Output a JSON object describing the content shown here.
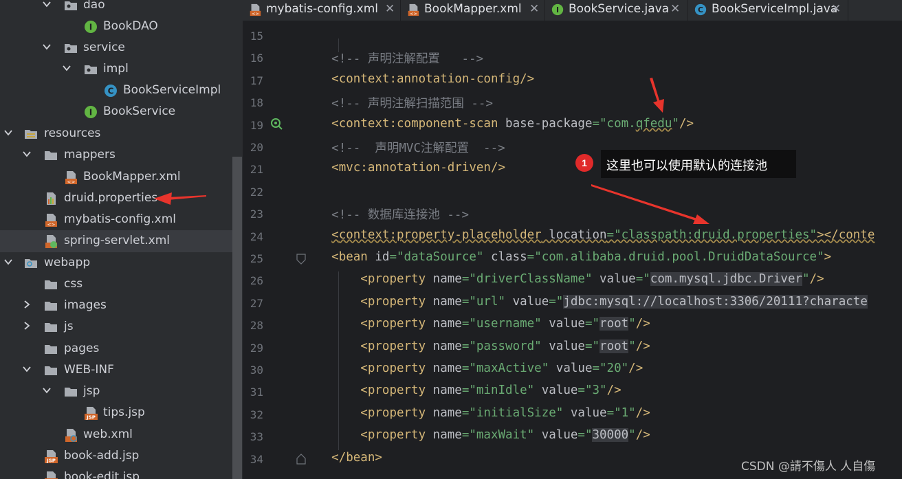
{
  "project_tree": [
    {
      "label": "dao",
      "icon": "package-folder-icon",
      "expanded": true
    },
    {
      "label": "BookDAO",
      "icon": "interface-icon"
    },
    {
      "label": "service",
      "icon": "package-folder-icon",
      "expanded": true
    },
    {
      "label": "impl",
      "icon": "package-folder-icon",
      "expanded": true
    },
    {
      "label": "BookServiceImpl",
      "icon": "class-icon"
    },
    {
      "label": "BookService",
      "icon": "interface-icon"
    },
    {
      "label": "resources",
      "icon": "resources-folder-icon",
      "expanded": true
    },
    {
      "label": "mappers",
      "icon": "folder-icon",
      "expanded": true
    },
    {
      "label": "BookMapper.xml",
      "icon": "xml-file-icon"
    },
    {
      "label": "druid.properties",
      "icon": "properties-file-icon"
    },
    {
      "label": "mybatis-config.xml",
      "icon": "xml-file-icon"
    },
    {
      "label": "spring-servlet.xml",
      "icon": "spring-xml-icon",
      "selected": true
    },
    {
      "label": "webapp",
      "icon": "web-folder-icon",
      "expanded": true
    },
    {
      "label": "css",
      "icon": "folder-icon"
    },
    {
      "label": "images",
      "icon": "folder-icon",
      "expanded": false
    },
    {
      "label": "js",
      "icon": "folder-icon",
      "expanded": false
    },
    {
      "label": "pages",
      "icon": "folder-icon"
    },
    {
      "label": "WEB-INF",
      "icon": "folder-icon",
      "expanded": true
    },
    {
      "label": "jsp",
      "icon": "folder-icon",
      "expanded": true
    },
    {
      "label": "tips.jsp",
      "icon": "jsp-file-icon"
    },
    {
      "label": "web.xml",
      "icon": "web-xml-icon"
    },
    {
      "label": "book-add.jsp",
      "icon": "jsp-file-icon"
    },
    {
      "label": "book-edit.jsp",
      "icon": "jsp-file-icon"
    }
  ],
  "tabs": [
    {
      "label": "mybatis-config.xml",
      "icon": "xml-file-icon",
      "close": "✕"
    },
    {
      "label": "BookMapper.xml",
      "icon": "xml-file-icon",
      "close": "✕"
    },
    {
      "label": "BookService.java",
      "icon": "interface-icon",
      "close": "✕"
    },
    {
      "label": "BookServiceImpl.java",
      "icon": "class-icon",
      "close": "✕"
    }
  ],
  "editor": {
    "line_numbers": [
      "15",
      "16",
      "17",
      "18",
      "19",
      "20",
      "21",
      "22",
      "23",
      "24",
      "25",
      "26",
      "27",
      "28",
      "29",
      "30",
      "31",
      "32",
      "33",
      "34"
    ],
    "lines": [
      [],
      [
        {
          "t": "    "
        },
        {
          "t": "<!-- 声明注解配置   -->",
          "c": "cm"
        }
      ],
      [
        {
          "t": "    "
        },
        {
          "t": "<",
          "c": "tg"
        },
        {
          "t": "context:",
          "c": "nm"
        },
        {
          "t": "annotation-config",
          "c": "tg"
        },
        {
          "t": "/>",
          "c": "tg"
        }
      ],
      [
        {
          "t": "    "
        },
        {
          "t": "<!-- 声明注解扫描范围 -->",
          "c": "cm"
        }
      ],
      [
        {
          "t": "    "
        },
        {
          "t": "<",
          "c": "tg"
        },
        {
          "t": "context:",
          "c": "nm"
        },
        {
          "t": "component-scan",
          "c": "tg"
        },
        {
          "t": " base-package",
          "c": "at"
        },
        {
          "t": "=\"com.",
          "c": "st"
        },
        {
          "t": "qfedu",
          "c": "st sq"
        },
        {
          "t": "\"",
          "c": "st"
        },
        {
          "t": "/>",
          "c": "tg"
        }
      ],
      [
        {
          "t": "    "
        },
        {
          "t": "<!--  声明MVC注解配置  -->",
          "c": "cm"
        }
      ],
      [
        {
          "t": "    "
        },
        {
          "t": "<",
          "c": "tg"
        },
        {
          "t": "mvc:",
          "c": "nm"
        },
        {
          "t": "annotation-driven",
          "c": "tg"
        },
        {
          "t": "/>",
          "c": "tg"
        }
      ],
      [],
      [
        {
          "t": "    "
        },
        {
          "t": "<!-- 数据库连接池 -->",
          "c": "cm"
        }
      ],
      [
        {
          "t": "    "
        },
        {
          "t": "<",
          "c": "tg sq"
        },
        {
          "t": "context:",
          "c": "nm sq"
        },
        {
          "t": "property-placeholder",
          "c": "tg sq"
        },
        {
          "t": " location",
          "c": "at sq"
        },
        {
          "t": "=\"classpath:druid.properties\"",
          "c": "st sq"
        },
        {
          "t": "></conte",
          "c": "tg sq"
        }
      ],
      [
        {
          "t": "    "
        },
        {
          "t": "<",
          "c": "tg"
        },
        {
          "t": "bean",
          "c": "tg"
        },
        {
          "t": " id",
          "c": "at"
        },
        {
          "t": "=\"dataSource\"",
          "c": "st"
        },
        {
          "t": " class",
          "c": "at"
        },
        {
          "t": "=\"com.alibaba.druid.pool.DruidDataSource\"",
          "c": "st"
        },
        {
          "t": ">",
          "c": "tg"
        }
      ],
      [
        {
          "t": "        "
        },
        {
          "t": "<",
          "c": "tg"
        },
        {
          "t": "property",
          "c": "tg"
        },
        {
          "t": " name",
          "c": "at"
        },
        {
          "t": "=\"driverClassName\"",
          "c": "st"
        },
        {
          "t": " value",
          "c": "at"
        },
        {
          "t": "=\"",
          "c": "st"
        },
        {
          "t": "com.mysql.jdbc.Driver",
          "c": "vh"
        },
        {
          "t": "\"",
          "c": "st"
        },
        {
          "t": "/>",
          "c": "tg"
        }
      ],
      [
        {
          "t": "        "
        },
        {
          "t": "<",
          "c": "tg"
        },
        {
          "t": "property",
          "c": "tg"
        },
        {
          "t": " name",
          "c": "at"
        },
        {
          "t": "=\"url\"",
          "c": "st"
        },
        {
          "t": " value",
          "c": "at"
        },
        {
          "t": "=\"",
          "c": "st"
        },
        {
          "t": "jdbc:mysql://localhost:3306/20111?characte",
          "c": "vh"
        }
      ],
      [
        {
          "t": "        "
        },
        {
          "t": "<",
          "c": "tg"
        },
        {
          "t": "property",
          "c": "tg"
        },
        {
          "t": " name",
          "c": "at"
        },
        {
          "t": "=\"username\"",
          "c": "st"
        },
        {
          "t": " value",
          "c": "at"
        },
        {
          "t": "=\"",
          "c": "st"
        },
        {
          "t": "root",
          "c": "vh"
        },
        {
          "t": "\"",
          "c": "st"
        },
        {
          "t": "/>",
          "c": "tg"
        }
      ],
      [
        {
          "t": "        "
        },
        {
          "t": "<",
          "c": "tg"
        },
        {
          "t": "property",
          "c": "tg"
        },
        {
          "t": " name",
          "c": "at"
        },
        {
          "t": "=\"password\"",
          "c": "st"
        },
        {
          "t": " value",
          "c": "at"
        },
        {
          "t": "=\"",
          "c": "st"
        },
        {
          "t": "root",
          "c": "vh"
        },
        {
          "t": "\"",
          "c": "st"
        },
        {
          "t": "/>",
          "c": "tg"
        }
      ],
      [
        {
          "t": "        "
        },
        {
          "t": "<",
          "c": "tg"
        },
        {
          "t": "property",
          "c": "tg"
        },
        {
          "t": " name",
          "c": "at"
        },
        {
          "t": "=\"maxActive\"",
          "c": "st"
        },
        {
          "t": " value",
          "c": "at"
        },
        {
          "t": "=\"20\"",
          "c": "st"
        },
        {
          "t": "/>",
          "c": "tg"
        }
      ],
      [
        {
          "t": "        "
        },
        {
          "t": "<",
          "c": "tg"
        },
        {
          "t": "property",
          "c": "tg"
        },
        {
          "t": " name",
          "c": "at"
        },
        {
          "t": "=\"minIdle\"",
          "c": "st"
        },
        {
          "t": " value",
          "c": "at"
        },
        {
          "t": "=\"3\"",
          "c": "st"
        },
        {
          "t": "/>",
          "c": "tg"
        }
      ],
      [
        {
          "t": "        "
        },
        {
          "t": "<",
          "c": "tg"
        },
        {
          "t": "property",
          "c": "tg"
        },
        {
          "t": " name",
          "c": "at"
        },
        {
          "t": "=\"initialSize\"",
          "c": "st"
        },
        {
          "t": " value",
          "c": "at"
        },
        {
          "t": "=\"1\"",
          "c": "st"
        },
        {
          "t": "/>",
          "c": "tg"
        }
      ],
      [
        {
          "t": "        "
        },
        {
          "t": "<",
          "c": "tg"
        },
        {
          "t": "property",
          "c": "tg"
        },
        {
          "t": " name",
          "c": "at"
        },
        {
          "t": "=\"maxWait\"",
          "c": "st"
        },
        {
          "t": " value",
          "c": "at"
        },
        {
          "t": "=\"",
          "c": "st"
        },
        {
          "t": "30000",
          "c": "vh"
        },
        {
          "t": "\"",
          "c": "st"
        },
        {
          "t": "/>",
          "c": "tg"
        }
      ],
      [
        {
          "t": "    "
        },
        {
          "t": "</",
          "c": "tg"
        },
        {
          "t": "bean",
          "c": "tg"
        },
        {
          "t": ">",
          "c": "tg"
        }
      ]
    ]
  },
  "annotation": {
    "badge_number": "1",
    "bubble_text": "这里也可以使用默认的连接池",
    "arrow_color": "#e8342c"
  },
  "watermark": "CSDN @請不傷人 人自傷",
  "colors": {
    "sidebar_bg": "#2b2d30",
    "editor_bg": "#1e1f22",
    "selection": "#393b40",
    "tag": "#d5b778",
    "string": "#6aab73",
    "comment": "#7a7e85"
  }
}
